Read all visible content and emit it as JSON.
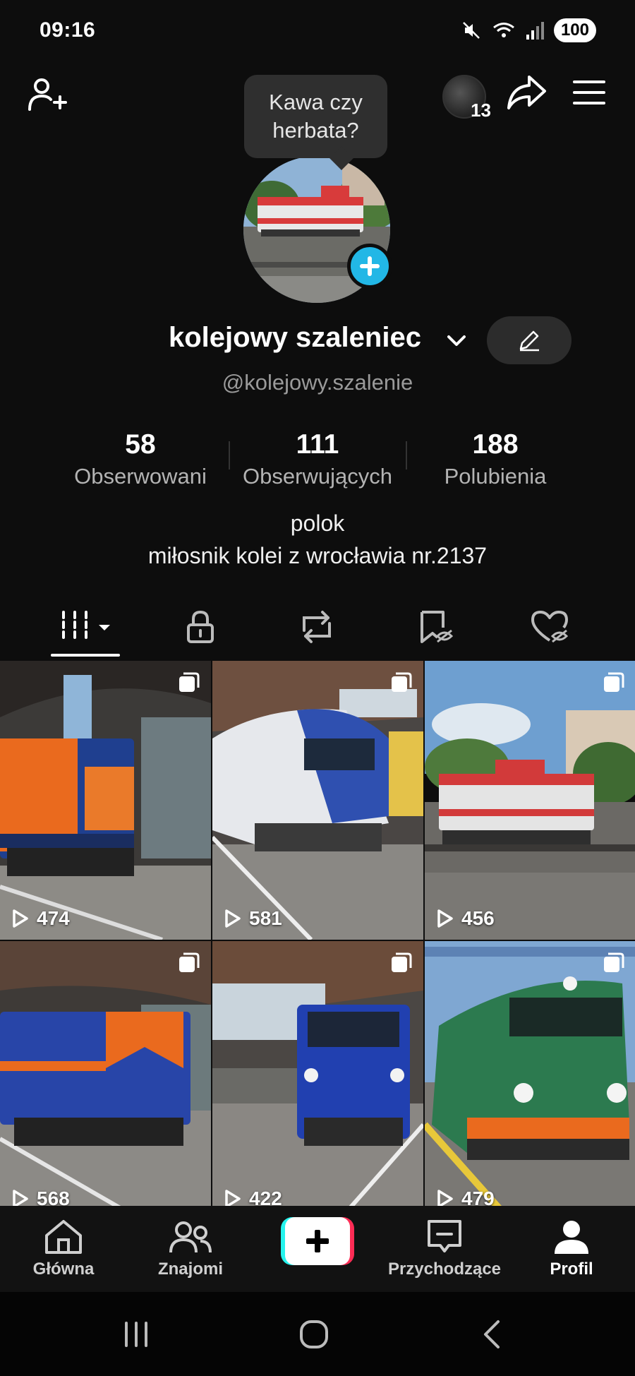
{
  "status_bar": {
    "time": "09:16",
    "battery": "100"
  },
  "top": {
    "visitors_count": "13"
  },
  "tooltip": {
    "line1": "Kawa czy",
    "line2": "herbata?"
  },
  "profile": {
    "display_name": "kolejowy szaleniec",
    "username": "@kolejowy.szalenie",
    "bio_line1": "polok",
    "bio_line2": "miłosnik kolei z wrocławia nr.2137"
  },
  "stats": [
    {
      "value": "58",
      "label": "Obserwowani"
    },
    {
      "value": "111",
      "label": "Obserwujących"
    },
    {
      "value": "188",
      "label": "Polubienia"
    }
  ],
  "tabs": [
    "videos-grid",
    "private",
    "reposts",
    "favorites",
    "liked"
  ],
  "videos": [
    {
      "views": "474"
    },
    {
      "views": "581"
    },
    {
      "views": "456"
    },
    {
      "views": "568"
    },
    {
      "views": "422"
    },
    {
      "views": "479"
    }
  ],
  "bottom_nav": {
    "home": "Główna",
    "friends": "Znajomi",
    "inbox": "Przychodzące",
    "profile": "Profil"
  },
  "colors": {
    "accent_cyan": "#22b7e6",
    "accent_pink": "#fe2c55",
    "background": "#0d0d0d"
  }
}
